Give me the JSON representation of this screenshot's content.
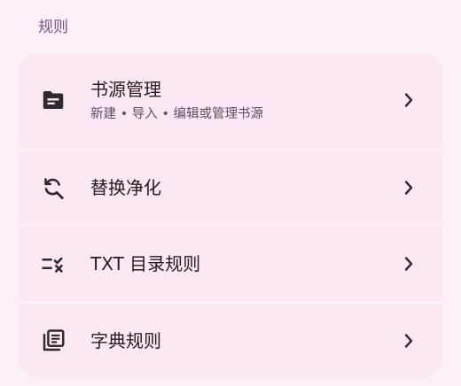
{
  "section": {
    "title": "规则"
  },
  "items": [
    {
      "title": "书源管理",
      "subtitle": "新建 • 导入 • 编辑或管理书源",
      "icon": "folder-icon"
    },
    {
      "title": "替换净化",
      "icon": "find-replace-icon"
    },
    {
      "title": "TXT 目录规则",
      "icon": "rule-list-icon"
    },
    {
      "title": "字典规则",
      "icon": "library-books-icon"
    }
  ],
  "colors": {
    "background": "#fdf1f9",
    "card": "#fbe8f4",
    "accent": "#7b4e8b",
    "text": "#241b24",
    "subtext": "#5d4f5d",
    "icon": "#2f2930"
  }
}
